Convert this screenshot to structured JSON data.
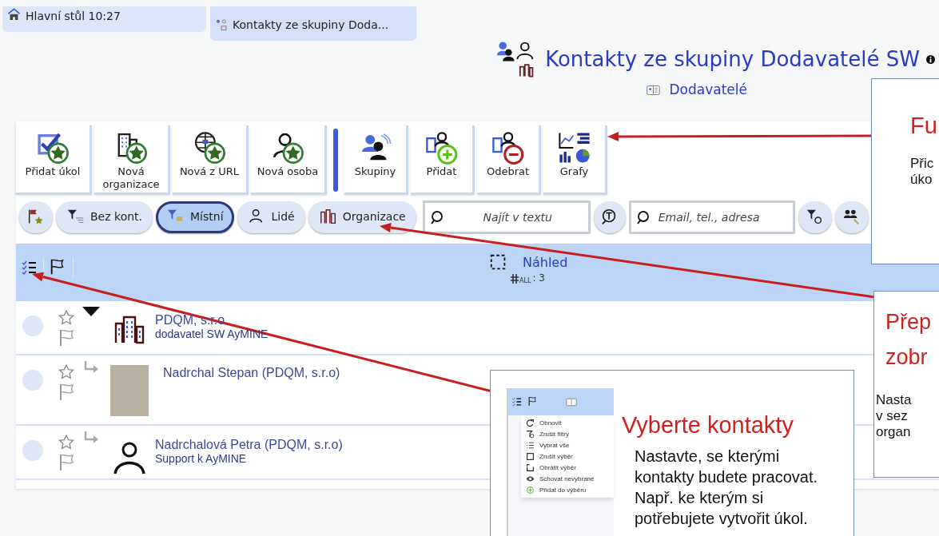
{
  "tabs": [
    {
      "label": "Hlavní stůl 10:27",
      "kind": "home",
      "selected": false
    },
    {
      "label": "Kontakty ze skupiny Doda...",
      "kind": "contacts",
      "selected": true
    }
  ],
  "header": {
    "title": "Kontakty ze skupiny Dodavatelé SW",
    "subtitle": "Dodavatelé"
  },
  "toolbar": [
    {
      "buttons": [
        {
          "label": "Přidat úkol",
          "kind": "task"
        },
        {
          "label": "Nová organizace",
          "kind": "organization"
        },
        {
          "label": "Nová z URL",
          "kind": "url"
        },
        {
          "label": "Nová osoba",
          "kind": "person"
        }
      ]
    },
    {
      "buttons": [
        {
          "label": "Skupiny",
          "kind": "groups"
        },
        {
          "label": "Přidat",
          "kind": "add"
        },
        {
          "label": "Odebrat",
          "kind": "remove"
        },
        {
          "label": "Grafy",
          "kind": "charts"
        }
      ]
    }
  ],
  "filters": [
    {
      "kind": "flag-star",
      "selected": false
    },
    {
      "label": "Bez kont.",
      "kind": "filter",
      "selected": false
    },
    {
      "label": "Místní",
      "kind": "local",
      "selected": true
    },
    {
      "label": "Lidé",
      "kind": "person",
      "selected": false
    },
    {
      "label": "Organizace",
      "kind": "organization",
      "selected": false
    }
  ],
  "search": [
    {
      "placeholder": "Najít v textu"
    },
    {
      "placeholder": "Email, tel., adresa"
    }
  ],
  "table": {
    "column": "Náhled",
    "count_label": "ALL",
    "count": ": 3",
    "rows": [
      {
        "name": "PDQM, s.r.o",
        "subtitle": "dodavatel SW AyMINE",
        "kind": "organization",
        "selected": false,
        "starred": false,
        "expanded": true,
        "children": [
          {
            "name": "Nadrchal Stepan (PDQM, s.r.o)",
            "kind": "photo",
            "selected": false,
            "starred": false
          },
          {
            "name": "Nadrchalová Petra (PDQM, s.r.o)",
            "subtitle": "Support k AyMINE",
            "kind": "person",
            "selected": false,
            "starred": false
          }
        ]
      }
    ]
  },
  "callouts": [
    {
      "title": [
        "Fu"
      ],
      "text": [
        "Přic",
        "úko"
      ]
    },
    {
      "title": [
        "Přep",
        "zobr"
      ],
      "text": [
        "Nasta",
        "v sez",
        "organ"
      ]
    },
    {
      "title": [
        "Vyberte kontakty"
      ],
      "text": [
        "Nastavte, se kterými",
        "kontakty budete pracovat.",
        "Např. ke kterým si",
        "potřebujete vytvořit úkol."
      ],
      "menu": [
        {
          "label": "Obnovit",
          "kind": "refresh"
        },
        {
          "label": "Zrušit filtry",
          "kind": "clear-filter"
        },
        {
          "label": "Vybrat vše",
          "kind": "select-all"
        },
        {
          "label": "Zrušit výběr",
          "kind": "square"
        },
        {
          "label": "Obrátit výběr",
          "kind": "invert"
        },
        {
          "label": "Schovat nevybrané",
          "kind": "eye"
        },
        {
          "label": "Přidat do výběru",
          "kind": "plus"
        }
      ]
    }
  ]
}
